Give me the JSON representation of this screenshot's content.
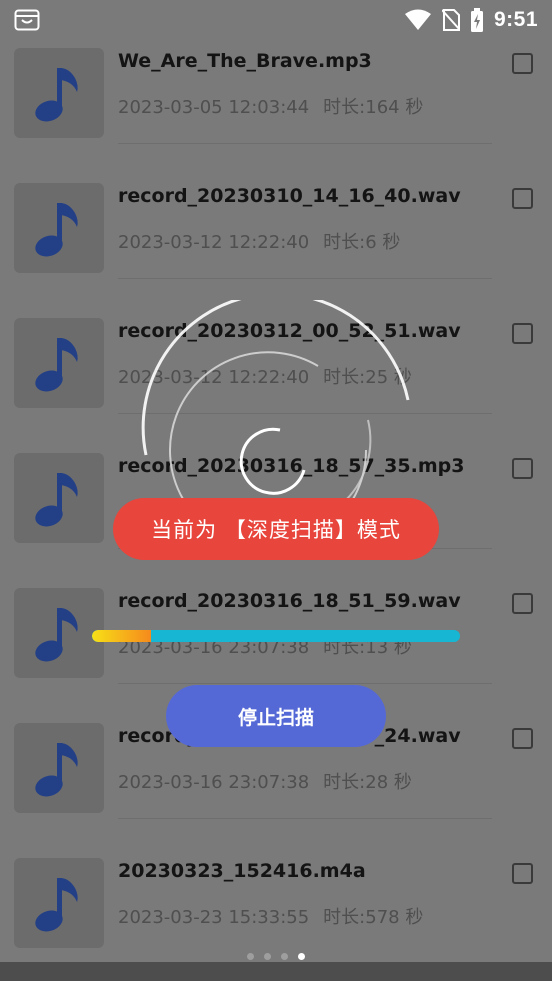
{
  "status_bar": {
    "time": "9:51"
  },
  "files": [
    {
      "name": "We_Are_The_Brave.mp3",
      "date": "2023-03-05 12:03:44",
      "duration": "时长:164 秒"
    },
    {
      "name": "record_20230310_14_16_40.wav",
      "date": "2023-03-12 12:22:40",
      "duration": "时长:6 秒"
    },
    {
      "name": "record_20230312_00_52_51.wav",
      "date": "2023-03-12 12:22:40",
      "duration": "时长:25 秒"
    },
    {
      "name": "record_20230316_18_57_35.mp3",
      "date": "",
      "duration": ""
    },
    {
      "name": "record_20230316_18_51_59.wav",
      "date": "2023-03-16 23:07:38",
      "duration": "时长:13 秒"
    },
    {
      "name": "record_20230316_18_54_24.wav",
      "date": "2023-03-16 23:07:38",
      "duration": "时长:28 秒"
    },
    {
      "name": "20230323_152416.m4a",
      "date": "2023-03-23 15:33:55",
      "duration": "时长:578 秒"
    }
  ],
  "scan": {
    "mode_text": "当前为 【深度扫描】模式",
    "progress_fraction": 0.16,
    "stop_label": "停止扫描"
  },
  "pager": {
    "count": 4,
    "active_index": 3
  },
  "colors": {
    "mode_pill": "#e8453c",
    "stop_button": "#5569d6",
    "progress_track": "#17b7d3",
    "music_icon": "#233f86"
  }
}
